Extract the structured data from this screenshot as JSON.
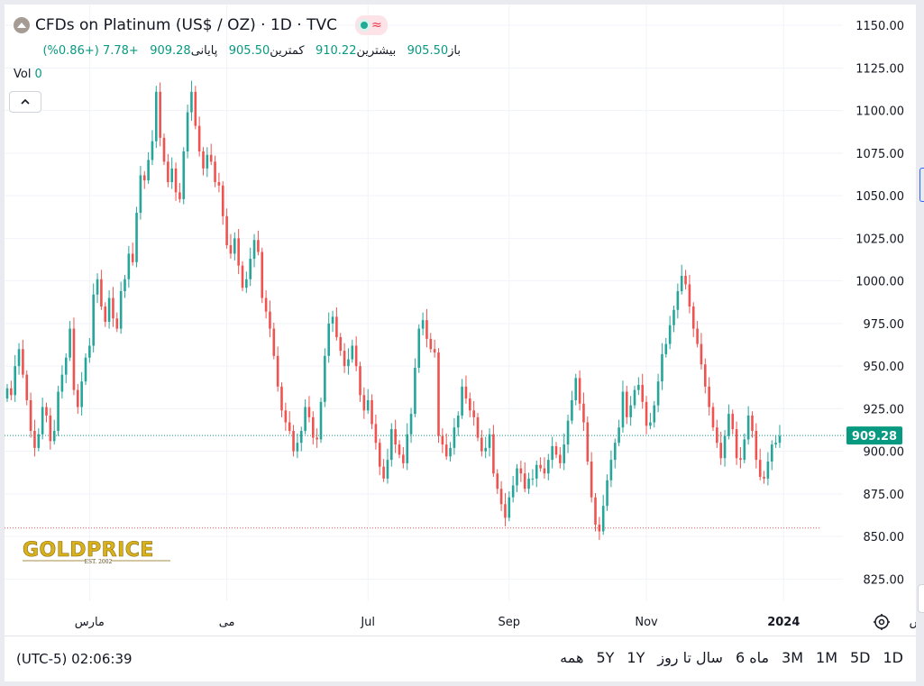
{
  "legend": {
    "title": "CFDs on Platinum (US$ / OZ) · 1D · TVC",
    "ohlc": [
      {
        "label": "باز",
        "value": "905.50"
      },
      {
        "label": "بیشترین",
        "value": "910.22"
      },
      {
        "label": "کمترین",
        "value": "905.50"
      },
      {
        "label": "پایانی",
        "value": "909.28"
      },
      {
        "label": "",
        "value": "+7.78 (+0.86%)"
      }
    ],
    "vol_label": "Vol",
    "vol_value": "0"
  },
  "logo": {
    "text": "GOLDPRICE",
    "subtext": "EST. 2002"
  },
  "bottom_bar": {
    "timezone": "(UTC-5) 02:06:39",
    "ranges": [
      "1D",
      "5D",
      "1M",
      "3M",
      "6 ماه",
      "سال تا روز",
      "1Y",
      "5Y",
      "همه"
    ]
  },
  "icons": {
    "symbol": "platinum-symbol-icon",
    "collapse": "chevron-up-icon",
    "settings": "gear-icon",
    "status": "market-status-icon"
  },
  "colors": {
    "up": "#26a69a",
    "down": "#ef5350",
    "price_line": "#089981",
    "grid": "#f0f3fa",
    "text": "#131722"
  },
  "chart_data": {
    "type": "candlestick",
    "timeframe": "1D",
    "ylim": [
      812,
      1158
    ],
    "y_ticks": [
      1150.0,
      1125.0,
      1100.0,
      1075.0,
      1050.0,
      1025.0,
      1000.0,
      975.0,
      950.0,
      925.0,
      900.0,
      875.0,
      850.0,
      825.0
    ],
    "x_ticks": [
      {
        "label": "مارس",
        "index": 21,
        "bold": false
      },
      {
        "label": "می",
        "index": 56,
        "bold": false
      },
      {
        "label": "Jul",
        "index": 92,
        "bold": false
      },
      {
        "label": "Sep",
        "index": 128,
        "bold": false
      },
      {
        "label": "Nov",
        "index": 163,
        "bold": false
      },
      {
        "label": "2024",
        "index": 198,
        "bold": true
      },
      {
        "label": "ارس",
        "index": 233,
        "bold": false
      }
    ],
    "last_price": 909.28,
    "last_price_label": "909.28",
    "low_marker": 855,
    "closes": [
      937,
      933,
      950,
      960,
      945,
      930,
      912,
      902,
      910,
      926,
      921,
      906,
      912,
      935,
      945,
      955,
      972,
      936,
      926,
      941,
      955,
      962,
      992,
      1001,
      985,
      976,
      990,
      978,
      972,
      994,
      1001,
      1016,
      1011,
      1040,
      1062,
      1059,
      1071,
      1082,
      1111,
      1084,
      1070,
      1058,
      1066,
      1052,
      1048,
      1076,
      1099,
      1111,
      1091,
      1076,
      1066,
      1074,
      1070,
      1058,
      1056,
      1038,
      1021,
      1016,
      1025,
      1009,
      996,
      1001,
      1013,
      1024,
      1017,
      990,
      982,
      972,
      956,
      938,
      924,
      917,
      912,
      900,
      905,
      912,
      926,
      920,
      908,
      907,
      929,
      956,
      975,
      979,
      967,
      959,
      950,
      954,
      962,
      950,
      933,
      924,
      930,
      916,
      905,
      891,
      884,
      895,
      913,
      904,
      898,
      893,
      910,
      922,
      949,
      972,
      977,
      966,
      960,
      958,
      909,
      904,
      897,
      902,
      914,
      921,
      938,
      931,
      924,
      920,
      908,
      900,
      902,
      910,
      887,
      878,
      869,
      861,
      873,
      880,
      890,
      887,
      878,
      884,
      884,
      892,
      890,
      887,
      895,
      903,
      898,
      893,
      904,
      918,
      930,
      943,
      928,
      917,
      894,
      873,
      857,
      853,
      868,
      883,
      895,
      905,
      914,
      935,
      920,
      927,
      936,
      939,
      929,
      915,
      917,
      927,
      941,
      957,
      963,
      974,
      983,
      994,
      1003,
      998,
      985,
      972,
      963,
      951,
      938,
      926,
      914,
      905,
      896,
      909,
      922,
      913,
      896,
      895,
      907,
      921,
      912,
      895,
      885,
      884,
      894,
      904,
      905,
      909
    ]
  }
}
